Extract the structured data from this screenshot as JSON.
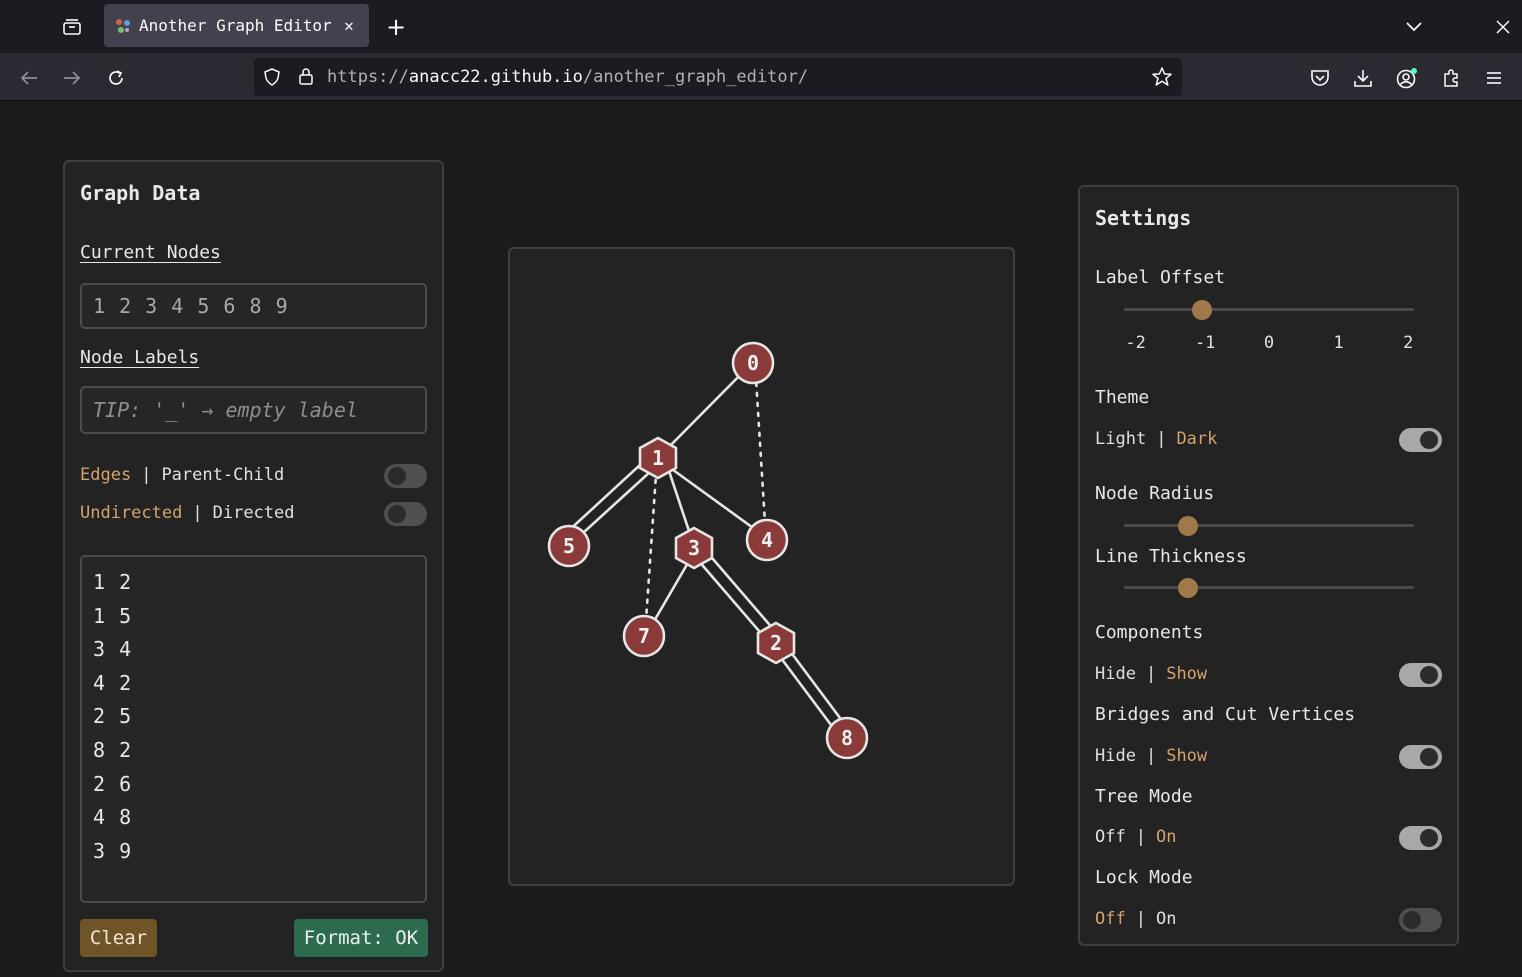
{
  "browser": {
    "tab_title": "Another Graph Editor",
    "url_prefix": "https://",
    "url_host": "anacc22.github.io",
    "url_path": "/another_graph_editor/"
  },
  "graph_data": {
    "title": "Graph Data",
    "current_nodes_label": "Current Nodes",
    "current_nodes_value": "1 2 3 4 5 6 8 9",
    "node_labels_label": "Node Labels",
    "node_labels_placeholder": "TIP: '_' → empty label",
    "edges_toggle": {
      "left": "Edges",
      "right": "Parent-Child",
      "state": "off"
    },
    "directed_toggle": {
      "left": "Undirected",
      "right": "Directed",
      "state": "off"
    },
    "edges": [
      "1 2",
      "1 5",
      "3 4",
      "4 2",
      "2 5",
      "8 2",
      "2 6",
      "4 8",
      "3 9"
    ],
    "clear_label": "Clear",
    "format_label": "Format: OK"
  },
  "graph": {
    "nodes": [
      {
        "label": "0",
        "shape": "circle"
      },
      {
        "label": "1",
        "shape": "hexagon"
      },
      {
        "label": "5",
        "shape": "circle"
      },
      {
        "label": "3",
        "shape": "hexagon"
      },
      {
        "label": "4",
        "shape": "circle"
      },
      {
        "label": "7",
        "shape": "circle"
      },
      {
        "label": "2",
        "shape": "hexagon"
      },
      {
        "label": "8",
        "shape": "circle"
      }
    ],
    "node_color": "#8b3a3a",
    "edge_color": "#e6e6e6"
  },
  "settings": {
    "title": "Settings",
    "label_offset_label": "Label Offset",
    "label_offset_ticks": [
      "-2",
      "-1",
      "0",
      "1",
      "2"
    ],
    "label_offset_value": -1,
    "theme_label": "Theme",
    "theme_toggle": {
      "left": "Light",
      "right": "Dark",
      "state": "on"
    },
    "node_radius_label": "Node Radius",
    "node_radius_value": 0.22,
    "line_thickness_label": "Line Thickness",
    "line_thickness_value": 0.22,
    "components_label": "Components",
    "components_toggle": {
      "left": "Hide",
      "right": "Show",
      "state": "on"
    },
    "bridges_label": "Bridges and Cut Vertices",
    "bridges_toggle": {
      "left": "Hide",
      "right": "Show",
      "state": "on"
    },
    "tree_mode_label": "Tree Mode",
    "tree_toggle": {
      "left": "Off",
      "right": "On",
      "state": "on"
    },
    "lock_mode_label": "Lock Mode",
    "lock_toggle": {
      "left": "Off",
      "right": "On",
      "state": "off"
    }
  },
  "colors": {
    "accent": "#d4a26a",
    "clear_button": "#6e5427",
    "format_button": "#2d6b4e",
    "node_fill": "#8b3a3a"
  }
}
